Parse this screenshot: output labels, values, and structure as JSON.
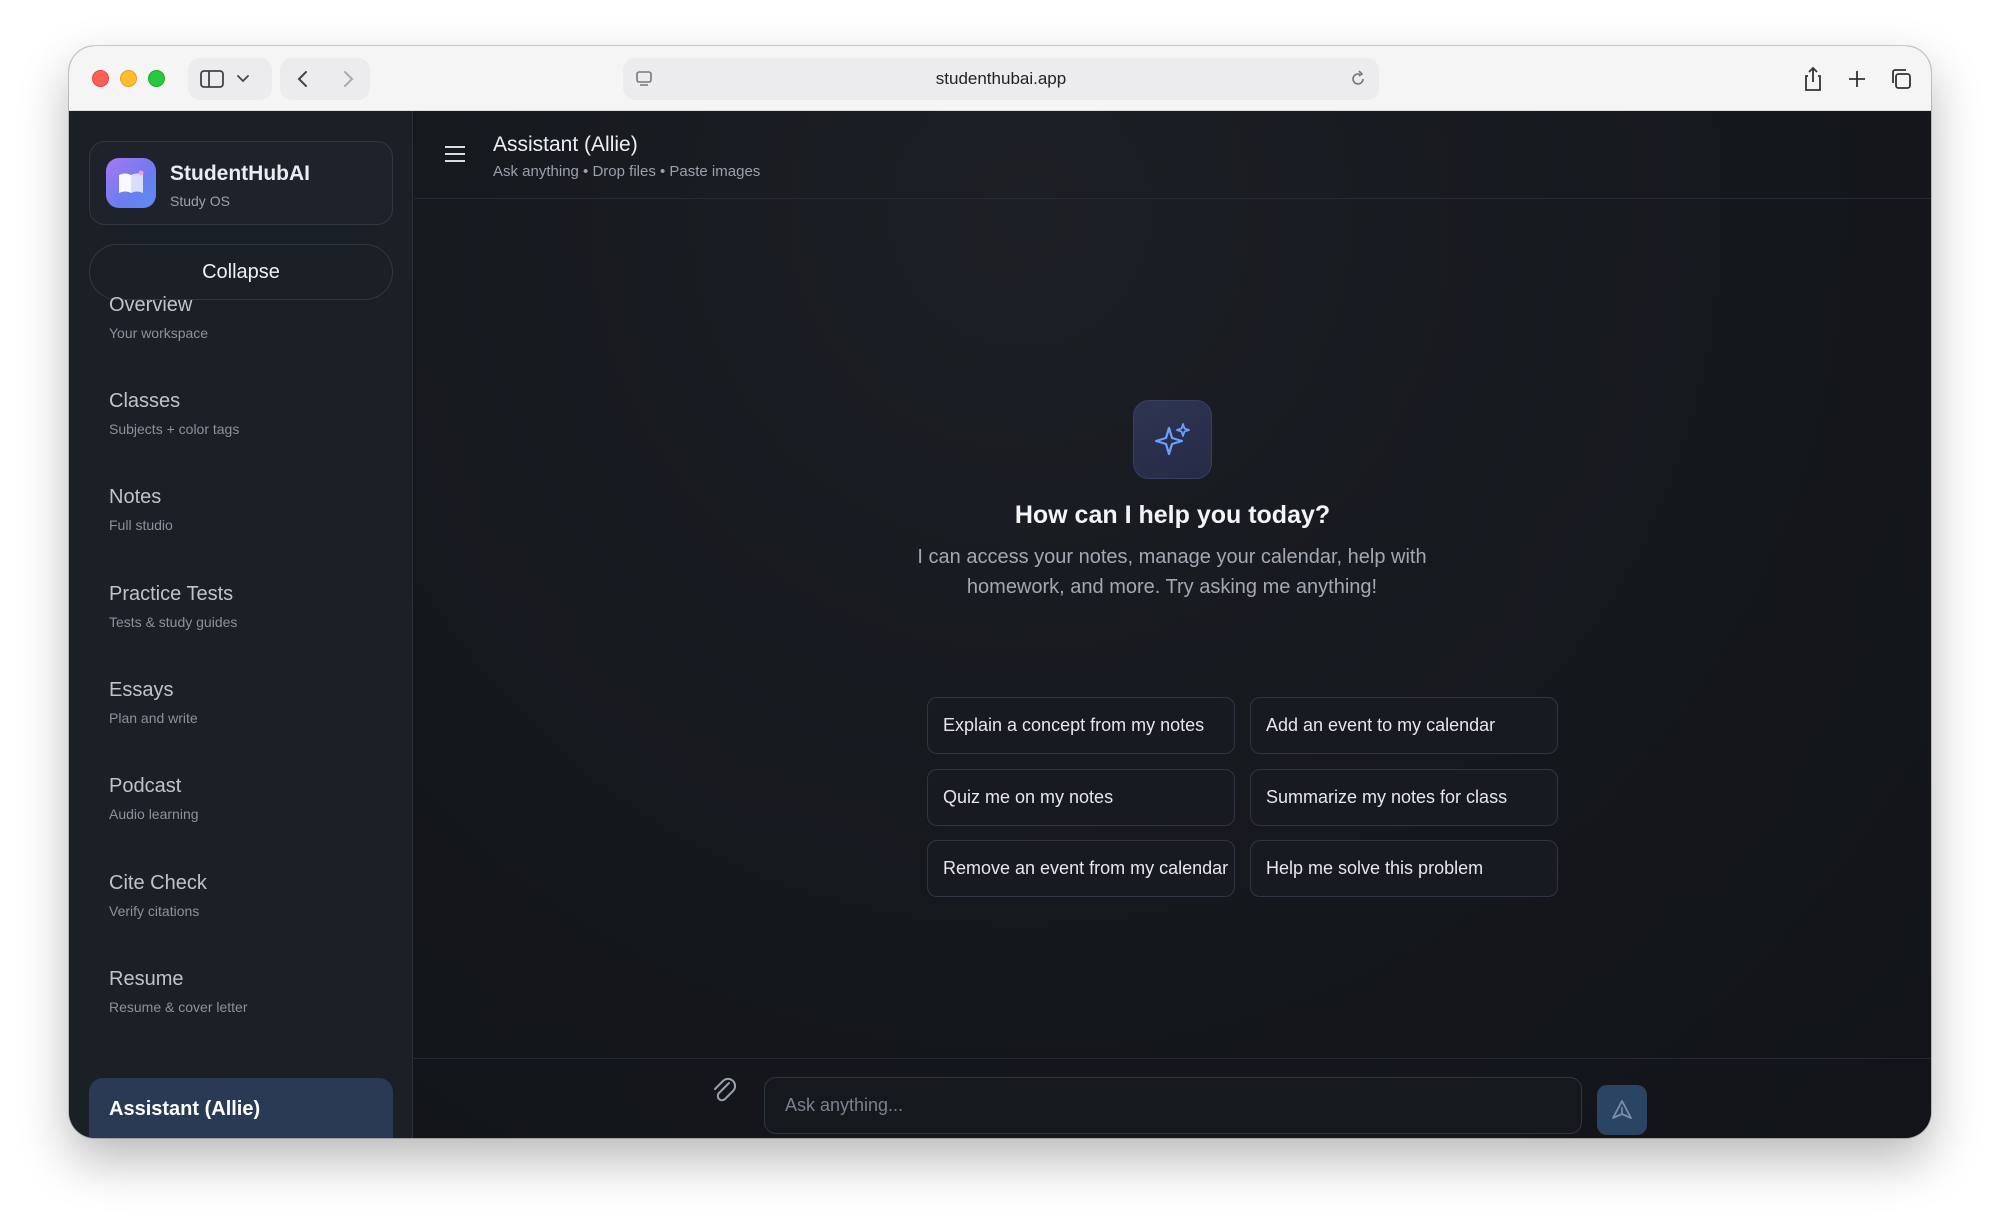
{
  "browser": {
    "url": "studenthubai.app"
  },
  "brand": {
    "name": "StudentHubAI",
    "subtitle": "Study OS"
  },
  "sidebar": {
    "collapse_label": "Collapse",
    "items": [
      {
        "label": "Overview",
        "sub": "Your workspace"
      },
      {
        "label": "Classes",
        "sub": "Subjects + color tags"
      },
      {
        "label": "Notes",
        "sub": "Full studio"
      },
      {
        "label": "Practice Tests",
        "sub": "Tests & study guides"
      },
      {
        "label": "Essays",
        "sub": "Plan and write"
      },
      {
        "label": "Podcast",
        "sub": "Audio learning"
      },
      {
        "label": "Cite Check",
        "sub": "Verify citations"
      },
      {
        "label": "Resume",
        "sub": "Resume & cover letter"
      }
    ],
    "active_item": "Assistant (Allie)"
  },
  "header": {
    "title": "Assistant (Allie)",
    "subtitle": "Ask anything • Drop files • Paste images"
  },
  "hero": {
    "icon": "sparkles-icon",
    "title": "How can I help you today?",
    "description": "I can access your notes, manage your calendar, help with homework, and more. Try asking me anything!"
  },
  "suggestions": [
    "Explain a concept from my notes",
    "Add an event to my calendar",
    "Quiz me on my notes",
    "Summarize my notes for class",
    "Remove an event from my calendar",
    "Help me solve this problem"
  ],
  "composer": {
    "placeholder": "Ask anything..."
  },
  "colors": {
    "accent": "#5b8ef0",
    "active_nav": "#2a3a54",
    "background": "#14171c"
  }
}
